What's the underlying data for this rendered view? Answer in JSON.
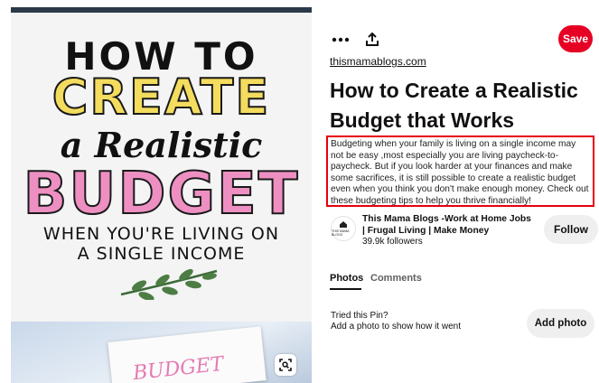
{
  "pin_image": {
    "line_how_to": "HOW TO",
    "line_create": "CREATE",
    "line_a_realistic": "a Realistic",
    "line_budget": "BUDGET",
    "line_sub_1": "WHEN YOU'RE LIVING ON",
    "line_sub_2": "A SINGLE INCOME",
    "photo_word": "BUDGET",
    "lens_icon": "visual-search-icon"
  },
  "actions": {
    "more_icon": "more-horizontal-icon",
    "share_icon": "share-upload-icon",
    "save_label": "Save",
    "save_color": "#e60023"
  },
  "pin": {
    "source": "thismamablogs.com",
    "title": "How to Create a Realistic Budget that Works",
    "description": "Budgeting when your family is living on a single income may not be easy ,most especially you are living paycheck-to-paycheck. But if you look harder at your finances and make some sacrifices, it is still possible to create a realistic budget even when you think you don't make enough money. Check out these budgeting tips to help you thrive financially! #budgetingtips #budgetingforbeginners",
    "highlight_color": "#e8000e"
  },
  "creator": {
    "avatar_text": "THIS MAMA BLOGS",
    "name": "This Mama Blogs -Work at Home Jobs | Frugal Living | Make Money",
    "followers": "39.9k followers",
    "follow_label": "Follow"
  },
  "tabs": [
    {
      "label": "Photos",
      "active": true
    },
    {
      "label": "Comments",
      "active": false
    }
  ],
  "tried": {
    "title": "Tried this Pin?",
    "subtitle": "Add a photo to show how it went",
    "button_label": "Add photo"
  }
}
